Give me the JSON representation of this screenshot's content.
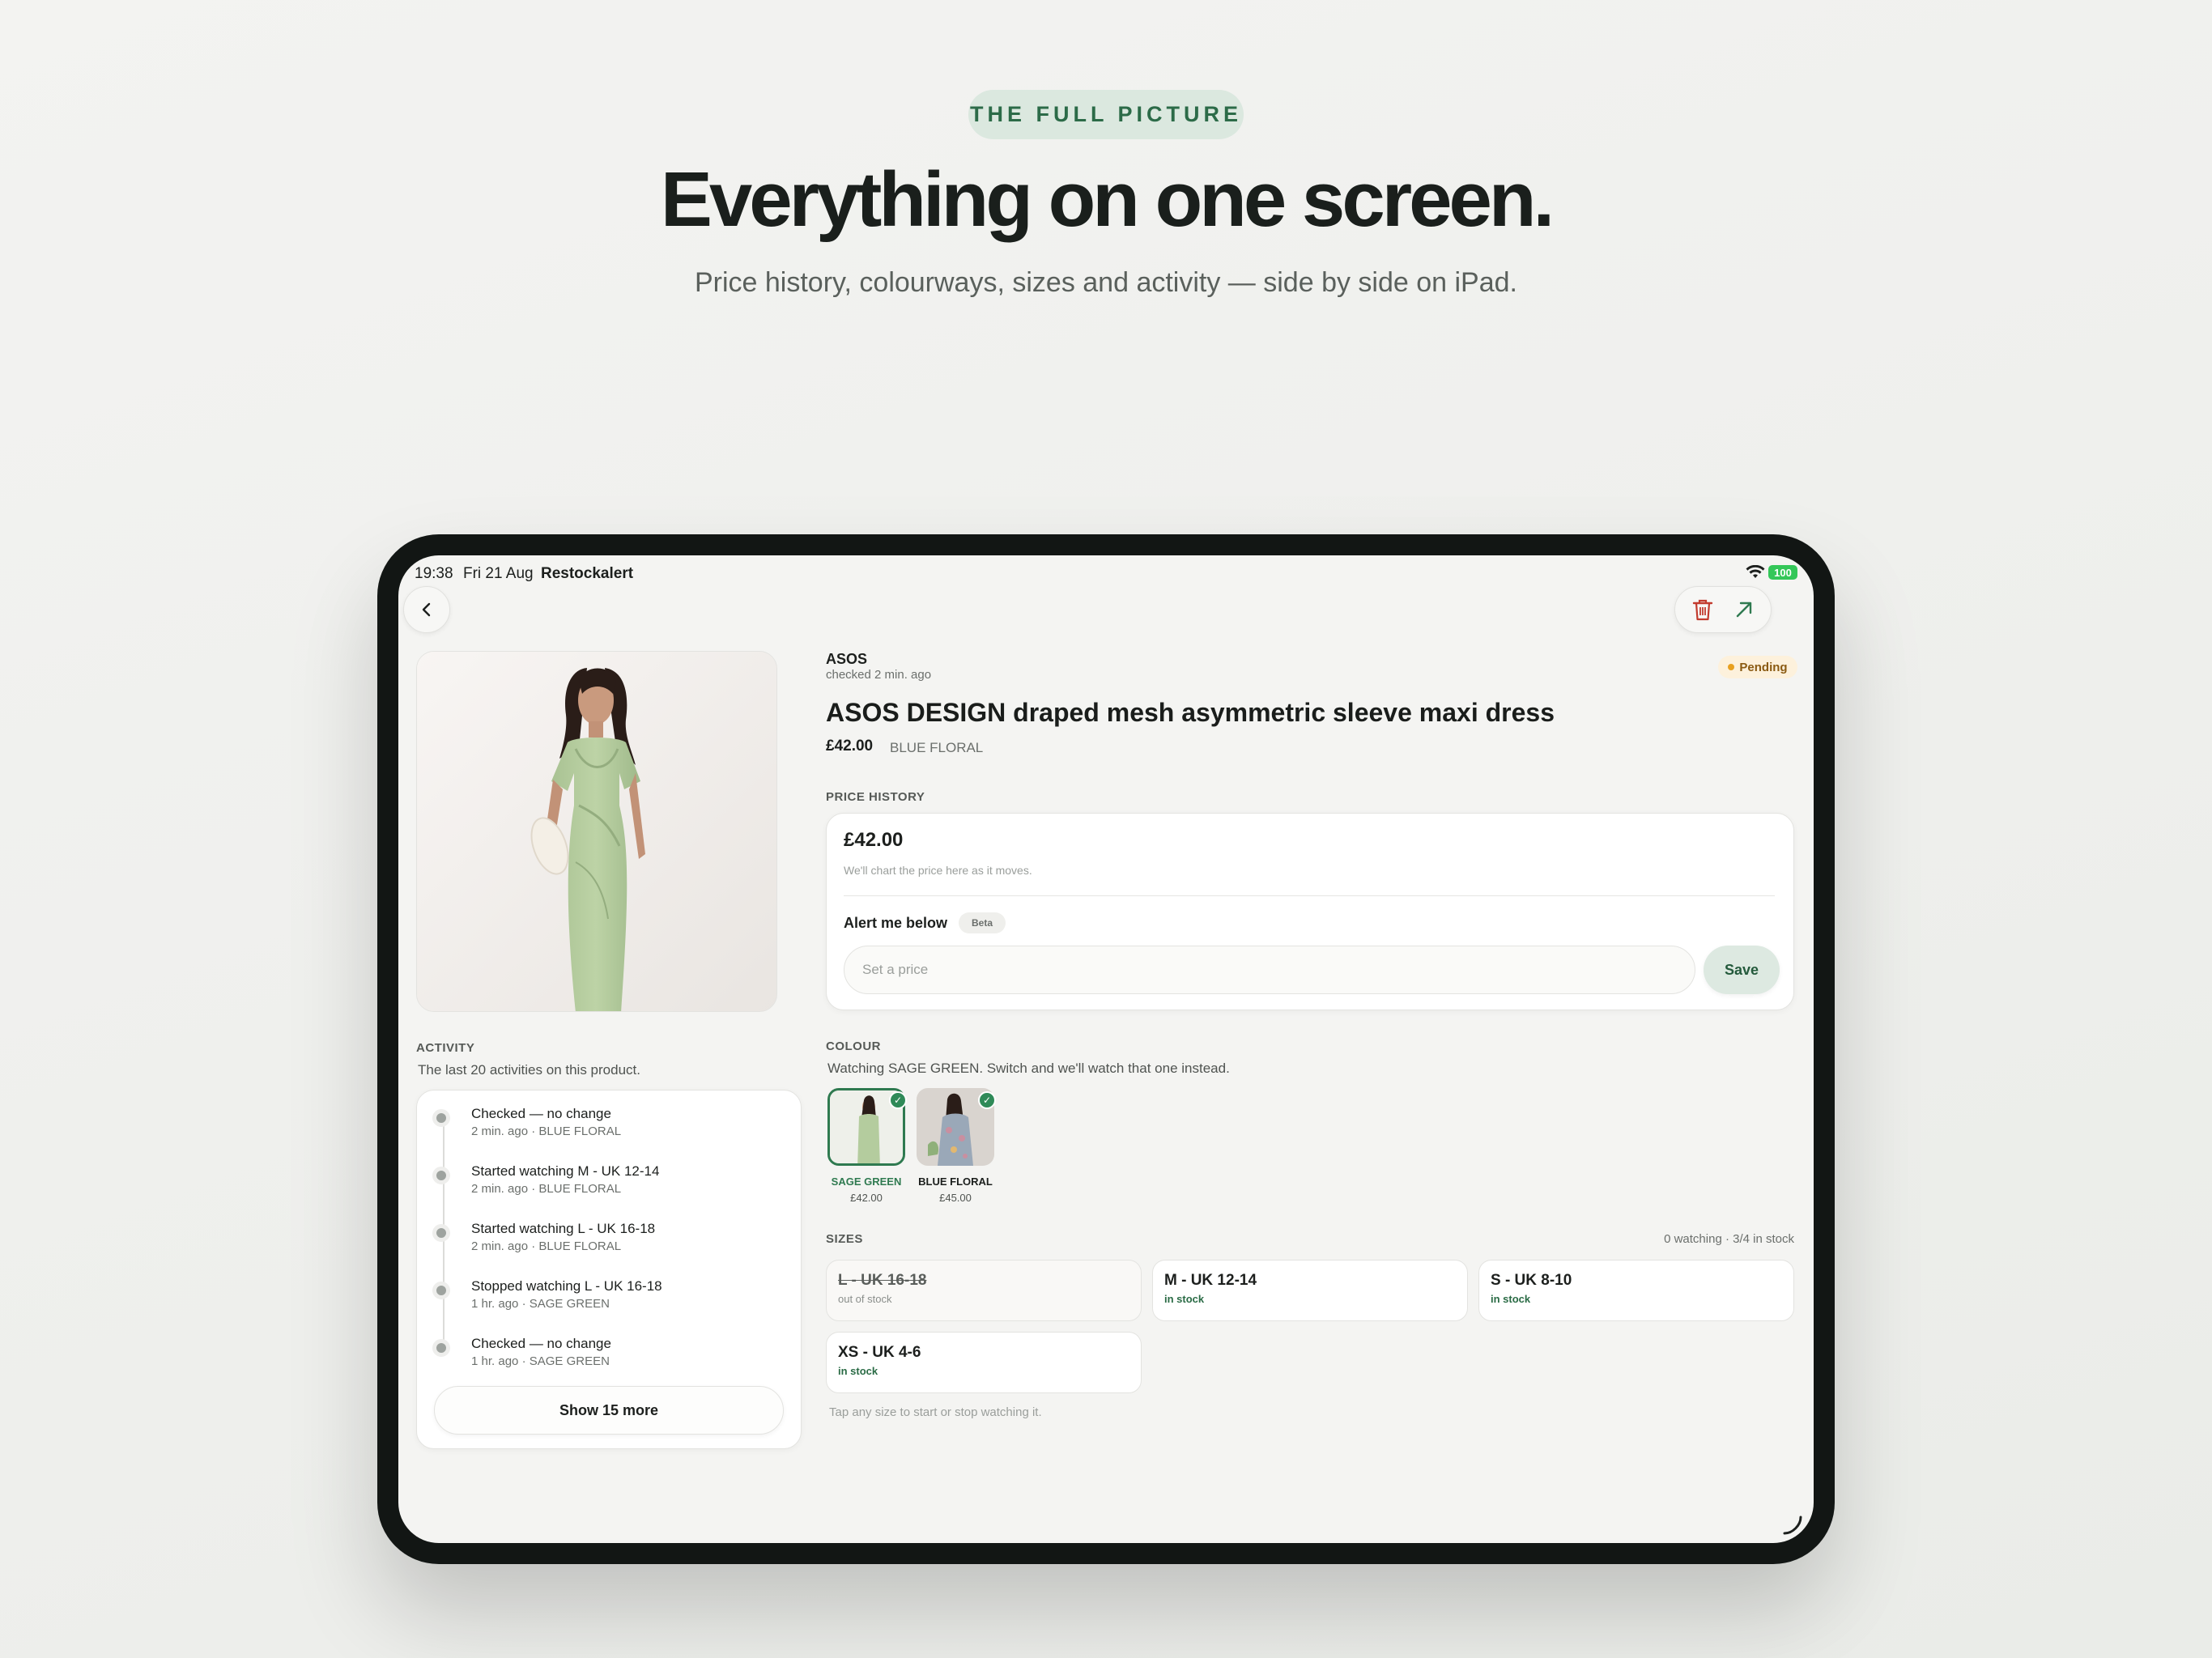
{
  "hero": {
    "eyebrow": "THE FULL PICTURE",
    "headline": "Everything on one screen.",
    "subhead": "Price history, colourways, sizes and activity — side by side on iPad."
  },
  "status_bar": {
    "time": "19:38",
    "date": "Fri 21 Aug",
    "app": "Restockalert",
    "battery": "100"
  },
  "nav": {
    "back_icon": "chevron-left-icon",
    "delete_icon": "trash-icon",
    "open_icon": "arrow-up-right-icon"
  },
  "product": {
    "brand": "ASOS",
    "checked": "checked 2 min. ago",
    "status": "Pending",
    "title": "ASOS DESIGN draped mesh asymmetric sleeve maxi dress",
    "price": "£42.00",
    "colour": "BLUE FLORAL"
  },
  "price_history": {
    "label": "PRICE HISTORY",
    "current": "£42.00",
    "hint": "We'll chart the price here as it moves.",
    "alert_label": "Alert me below",
    "beta": "Beta",
    "input_placeholder": "Set a price",
    "save": "Save"
  },
  "colour": {
    "label": "COLOUR",
    "description": "Watching SAGE GREEN. Switch and we'll watch that one instead.",
    "swatches": [
      {
        "name": "SAGE GREEN",
        "price": "£42.00",
        "selected": true
      },
      {
        "name": "BLUE FLORAL",
        "price": "£45.00",
        "selected": false
      }
    ]
  },
  "sizes": {
    "label": "SIZES",
    "summary": "0 watching · 3/4 in stock",
    "items": [
      {
        "name": "L - UK 16-18",
        "stock": "out of stock"
      },
      {
        "name": "M - UK 12-14",
        "stock": "in stock"
      },
      {
        "name": "S - UK 8-10",
        "stock": "in stock"
      },
      {
        "name": "XS - UK 4-6",
        "stock": "in stock"
      }
    ],
    "hint": "Tap any size to start or stop watching it."
  },
  "activity": {
    "label": "ACTIVITY",
    "subtitle": "The last 20 activities on this product.",
    "items": [
      {
        "title": "Checked — no change",
        "time": "2 min. ago",
        "colour": "BLUE FLORAL"
      },
      {
        "title": "Started watching M - UK 12-14",
        "time": "2 min. ago",
        "colour": "BLUE FLORAL"
      },
      {
        "title": "Started watching L - UK 16-18",
        "time": "2 min. ago",
        "colour": "BLUE FLORAL"
      },
      {
        "title": "Stopped watching L - UK 16-18",
        "time": "1 hr. ago",
        "colour": "SAGE GREEN"
      },
      {
        "title": "Checked — no change",
        "time": "1 hr. ago",
        "colour": "SAGE GREEN"
      }
    ],
    "meta_separator": "·",
    "show_more": "Show 15 more"
  },
  "colors": {
    "accent_green": "#2f7a50",
    "delete_red": "#c23b2e",
    "pending_amber": "#e8a020"
  }
}
